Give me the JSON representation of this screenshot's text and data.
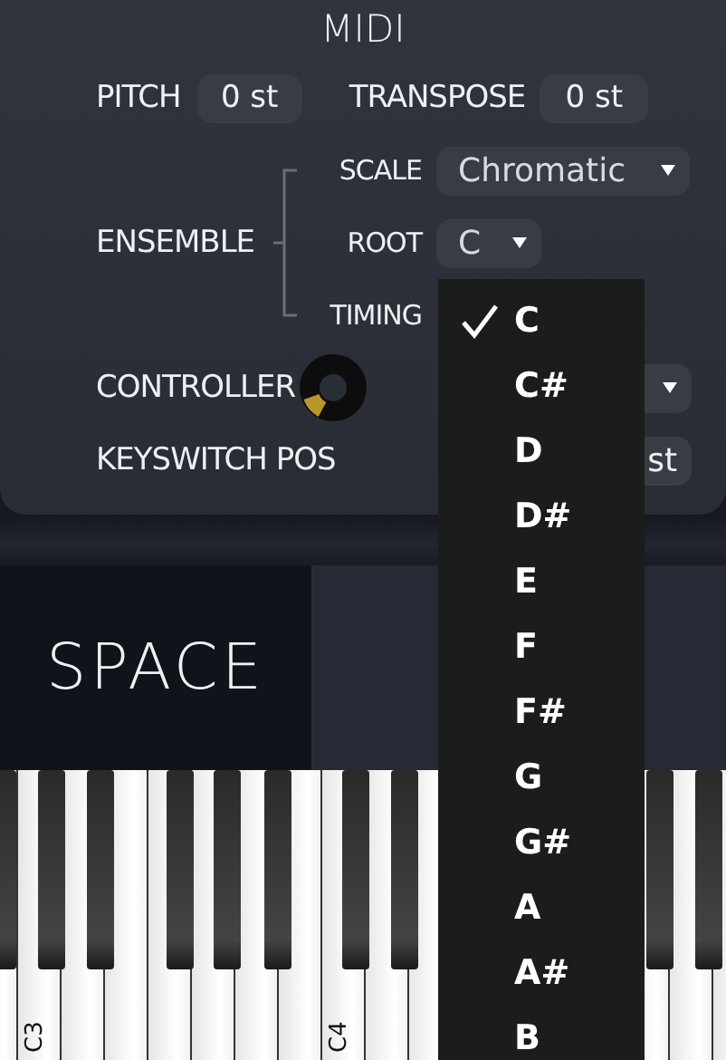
{
  "section": {
    "title": "MIDI"
  },
  "pitch": {
    "label": "PITCH",
    "value": "0 st"
  },
  "transpose": {
    "label": "TRANSPOSE",
    "value": "0 st"
  },
  "ensemble": {
    "label": "ENSEMBLE",
    "rows": [
      {
        "label": "SCALE",
        "value": "Chromatic"
      },
      {
        "label": "ROOT",
        "value": "C"
      },
      {
        "label": "TIMING"
      }
    ]
  },
  "controller": {
    "label": "CONTROLLER"
  },
  "keyswitch": {
    "label": "KEYSWITCH POS",
    "value": "st"
  },
  "tabs": [
    {
      "label": "SPACE",
      "selected": true
    },
    {
      "selected": false
    }
  ],
  "keyboard": {
    "labels": [
      "C3",
      "C4"
    ]
  },
  "root_menu": {
    "items": [
      {
        "label": "C",
        "checked": true
      },
      {
        "label": "C#",
        "checked": false
      },
      {
        "label": "D",
        "checked": false
      },
      {
        "label": "D#",
        "checked": false
      },
      {
        "label": "E",
        "checked": false
      },
      {
        "label": "F",
        "checked": false
      },
      {
        "label": "F#",
        "checked": false
      },
      {
        "label": "G",
        "checked": false
      },
      {
        "label": "G#",
        "checked": false
      },
      {
        "label": "A",
        "checked": false
      },
      {
        "label": "A#",
        "checked": false
      },
      {
        "label": "B",
        "checked": false
      }
    ]
  }
}
